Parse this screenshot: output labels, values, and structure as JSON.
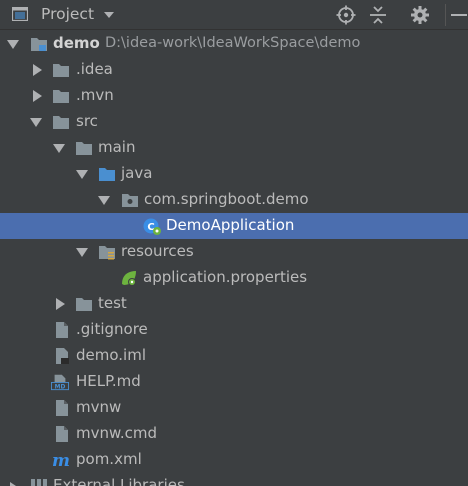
{
  "header": {
    "title": "Project",
    "icons": [
      "project-icon",
      "locate-icon",
      "collapse-icon",
      "gear-icon",
      "hide-icon"
    ]
  },
  "tree": {
    "root": {
      "name": "demo",
      "path": "D:\\idea-work\\IdeaWorkSpace\\demo"
    },
    "idea": ".idea",
    "mvn": ".mvn",
    "src": "src",
    "main": "main",
    "java": "java",
    "package": "com.springboot.demo",
    "demo_application": "DemoApplication",
    "resources": "resources",
    "application_properties": "application.properties",
    "test": "test",
    "gitignore": ".gitignore",
    "demo_iml": "demo.iml",
    "help_md": "HELP.md",
    "mvnw": "mvnw",
    "mvnw_cmd": "mvnw.cmd",
    "pom_xml": "pom.xml",
    "external_libraries": "External Libraries"
  },
  "colors": {
    "background": "#3c3f41",
    "selection": "#4b6eaf",
    "folder": "#87939a",
    "source_folder": "#4a8fd0",
    "spring_green": "#6db33f",
    "maven_blue": "#3a8ee6"
  }
}
